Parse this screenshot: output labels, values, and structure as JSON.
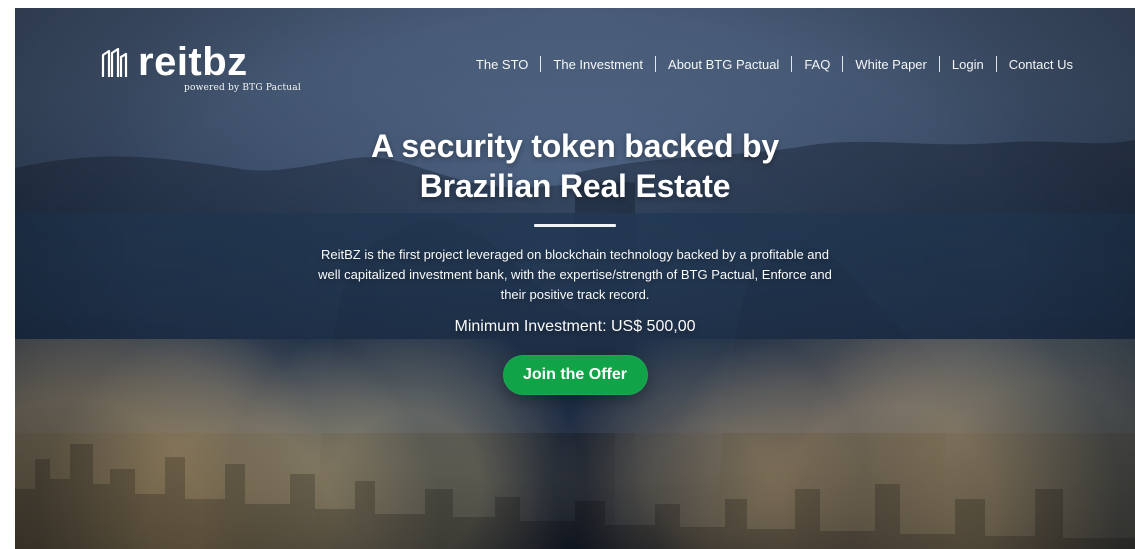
{
  "brand": {
    "name": "reitbz",
    "tagline": "powered by BTG Pactual"
  },
  "nav": {
    "items": [
      {
        "label": "The STO"
      },
      {
        "label": "The Investment"
      },
      {
        "label": "About BTG Pactual"
      },
      {
        "label": "FAQ"
      },
      {
        "label": "White Paper"
      },
      {
        "label": "Login"
      },
      {
        "label": "Contact Us"
      }
    ]
  },
  "hero": {
    "headline_line1": "A security token backed by",
    "headline_line2": "Brazilian Real Estate",
    "description": "ReitBZ is the first project leveraged on blockchain technology backed by a profitable and well capitalized investment bank, with the expertise/strength of BTG Pactual, Enforce and their positive track record.",
    "minimum_investment": "Minimum Investment: US$ 500,00",
    "cta_label": "Join the Offer"
  },
  "colors": {
    "cta_green": "#10a348",
    "text_white": "#ffffff"
  },
  "icons": {
    "logo_mark": "building-logo-icon"
  }
}
